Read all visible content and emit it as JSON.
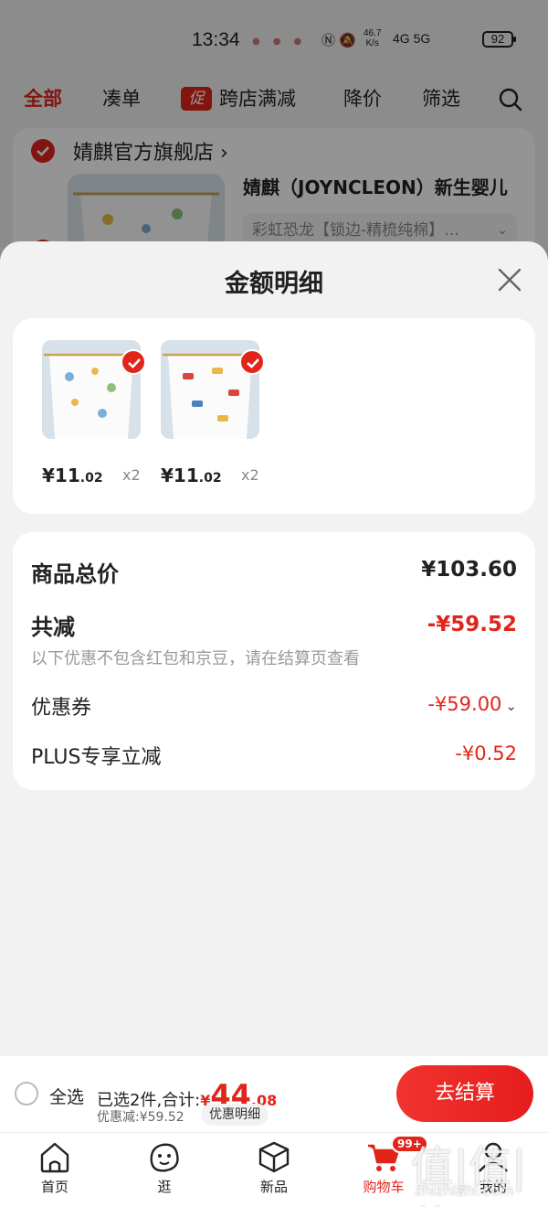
{
  "status_bar": {
    "time": "13:34",
    "net_speed_value": "46.7",
    "net_speed_unit": "K/s",
    "network_labels": "4G  5G",
    "battery": "92"
  },
  "filter_tabs": {
    "all": "全部",
    "bundle": "凑单",
    "promo_badge": "促",
    "cross_store": "跨店满减",
    "price_drop": "降价",
    "filter": "筛选"
  },
  "store": {
    "name": "婧麒官方旗舰店",
    "arrow": "›",
    "product_title": "婧麒（JOYNCLEON）新生婴儿",
    "product_spec": "彩虹恐龙【锁边-精梳纯棉】…"
  },
  "sheet": {
    "title": "金额明细",
    "items": [
      {
        "currency": "¥",
        "price_int": "11",
        "price_dec": ".02",
        "qty": "x2"
      },
      {
        "currency": "¥",
        "price_int": "11",
        "price_dec": ".02",
        "qty": "x2"
      }
    ],
    "summary": {
      "goods_total_label": "商品总价",
      "goods_total_value": "¥103.60",
      "total_reduce_label": "共减",
      "total_reduce_value": "-¥59.52",
      "note": "以下优惠不包含红包和京豆，请在结算页查看",
      "coupon_label": "优惠券",
      "coupon_value": "-¥59.00",
      "plus_label": "PLUS专享立减",
      "plus_value": "-¥0.52"
    }
  },
  "checkout": {
    "select_all": "全选",
    "selected_text": "已选2件,合计:",
    "total_currency": "¥",
    "total_int": "44",
    "total_dec": ".08",
    "discount_text": "优惠减:¥59.52",
    "detail_label": "优惠明细",
    "button_label": "去结算"
  },
  "bottom_nav": {
    "home": "首页",
    "browse": "逛",
    "new": "新品",
    "cart": "购物车",
    "cart_badge": "99+",
    "me": "我的"
  },
  "watermark": {
    "big": "值|值|值",
    "small": "zhizhizhi.com"
  },
  "colors": {
    "accent_red": "#e1251b",
    "background": "#f2f2f2",
    "card": "#ffffff"
  }
}
